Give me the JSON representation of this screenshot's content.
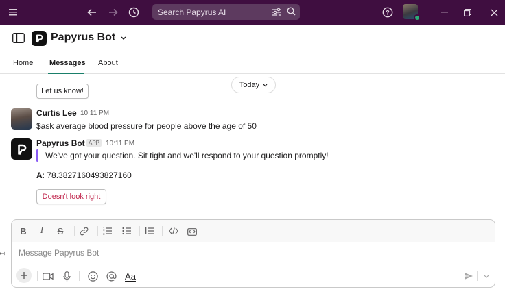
{
  "search": {
    "placeholder": "Search Papyrus AI"
  },
  "channel": {
    "title": "Papyrus Bot"
  },
  "tabs": [
    {
      "label": "Home"
    },
    {
      "label": "Messages"
    },
    {
      "label": "About"
    }
  ],
  "prior": {
    "button_label": "Let us know!"
  },
  "divider": {
    "label": "Today"
  },
  "messages": [
    {
      "author": "Curtis Lee",
      "time": "10:11 PM",
      "text": "$ask average blood pressure for people above the age of 50"
    },
    {
      "author": "Papyrus Bot",
      "badge": "APP",
      "time": "10:11 PM",
      "quote": "We've got your question. Sit tight and we'll respond to your question promptly!",
      "answer_label": "A",
      "answer_value": ": 78.3827160493827160",
      "feedback_label": "Doesn't look right"
    }
  ],
  "composer": {
    "placeholder": "Message Papyrus Bot",
    "format_label": "Aa"
  },
  "colors": {
    "sidebar": "#3f0e40",
    "accent": "#1a7f6a",
    "quote_bar": "#8a5cf5",
    "feedback": "#c0244b"
  }
}
